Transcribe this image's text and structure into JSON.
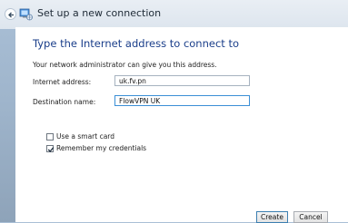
{
  "window": {
    "title": "Set up a new connection"
  },
  "page": {
    "heading": "Type the Internet address to connect to",
    "help_text": "Your network administrator can give you this address."
  },
  "form": {
    "internet_address": {
      "label": "Internet address:",
      "value": "uk.fv.pn"
    },
    "destination_name": {
      "label": "Destination name:",
      "value": "FlowVPN UK"
    }
  },
  "options": {
    "smart_card": {
      "label": "Use a smart card",
      "checked": false
    },
    "remember_credentials": {
      "label": "Remember my credentials",
      "checked": true
    }
  },
  "buttons": {
    "create": "Create",
    "cancel": "Cancel"
  },
  "colors": {
    "heading": "#1a3e8a",
    "focus_border": "#3b8fd6"
  }
}
